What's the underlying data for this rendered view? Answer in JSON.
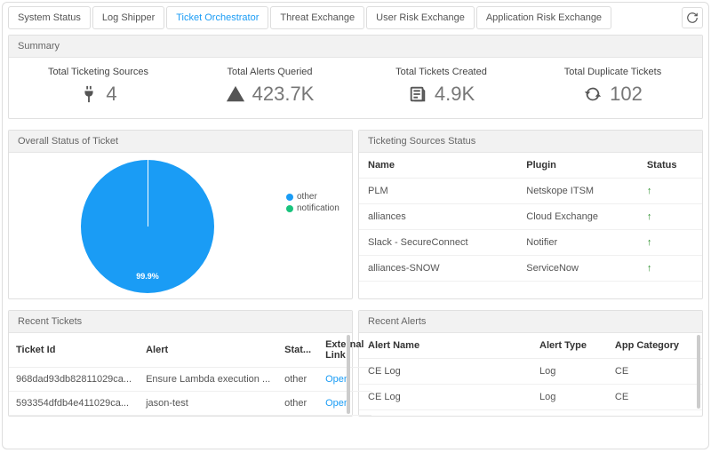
{
  "tabs": {
    "system_status": "System Status",
    "log_shipper": "Log Shipper",
    "ticket_orchestrator": "Ticket Orchestrator",
    "threat_exchange": "Threat Exchange",
    "user_risk_exchange": "User Risk Exchange",
    "app_risk_exchange": "Application Risk Exchange"
  },
  "summary": {
    "title": "Summary",
    "items": [
      {
        "label": "Total Ticketing Sources",
        "value": "4"
      },
      {
        "label": "Total Alerts Queried",
        "value": "423.7K"
      },
      {
        "label": "Total Tickets Created",
        "value": "4.9K"
      },
      {
        "label": "Total Duplicate Tickets",
        "value": "102"
      }
    ]
  },
  "chart_data": {
    "type": "pie",
    "title": "Overall Status of Ticket",
    "series": [
      {
        "name": "other",
        "value": 99.9,
        "color": "#1a9cf5"
      },
      {
        "name": "notification",
        "value": 0.1,
        "color": "#19c37d"
      }
    ],
    "center_label": "99.9%"
  },
  "sources_status": {
    "title": "Ticketing Sources Status",
    "headers": {
      "name": "Name",
      "plugin": "Plugin",
      "status": "Status"
    },
    "rows": [
      {
        "name": "PLM",
        "plugin": "Netskope ITSM",
        "status": "up"
      },
      {
        "name": "alliances",
        "plugin": "Cloud Exchange",
        "status": "up"
      },
      {
        "name": "Slack - SecureConnect",
        "plugin": "Notifier",
        "status": "up"
      },
      {
        "name": "alliances-SNOW",
        "plugin": "ServiceNow",
        "status": "up"
      }
    ]
  },
  "recent_tickets": {
    "title": "Recent Tickets",
    "headers": {
      "id": "Ticket Id",
      "alert": "Alert",
      "status": "Stat...",
      "link": "External Link"
    },
    "rows": [
      {
        "id": "968dad93db82811029ca...",
        "alert": "Ensure Lambda execution ...",
        "status": "other",
        "link": "Open"
      },
      {
        "id": "593354dfdb4e411029ca...",
        "alert": "jason-test",
        "status": "other",
        "link": "Open"
      }
    ]
  },
  "recent_alerts": {
    "title": "Recent Alerts",
    "headers": {
      "name": "Alert Name",
      "type": "Alert Type",
      "category": "App Category"
    },
    "rows": [
      {
        "name": "CE Log",
        "type": "Log",
        "category": "CE"
      },
      {
        "name": "CE Log",
        "type": "Log",
        "category": "CE"
      }
    ]
  },
  "status_glyphs": {
    "up": "↑"
  }
}
